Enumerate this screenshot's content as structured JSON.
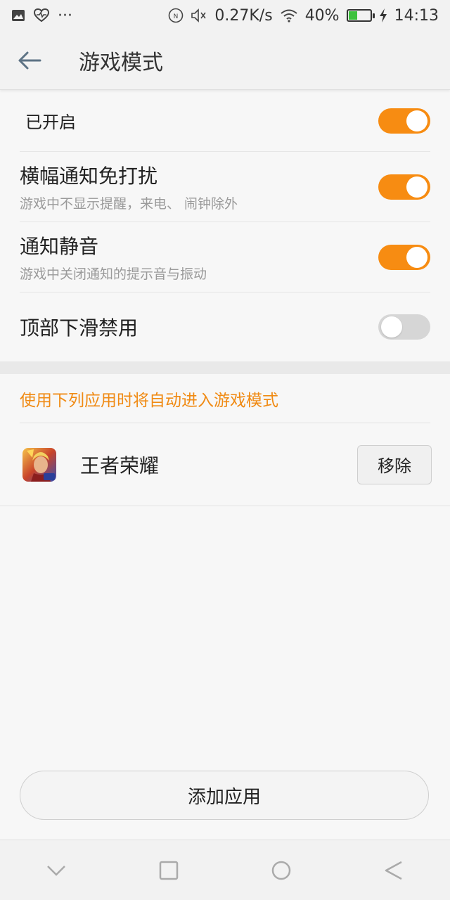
{
  "status_bar": {
    "left_icons": [
      "image-icon",
      "heart-pulse-icon",
      "more-icon"
    ],
    "more_glyph": "···",
    "net_speed": "0.27K/s",
    "battery_percent_text": "40%",
    "battery_level": 0.4,
    "time": "14:13"
  },
  "header": {
    "title": "游戏模式"
  },
  "settings": [
    {
      "title": "已开启",
      "subtitle": "",
      "on": true
    },
    {
      "title": "横幅通知免打扰",
      "subtitle": "游戏中不显示提醒，来电、 闹钟除外",
      "on": true
    },
    {
      "title": "通知静音",
      "subtitle": "游戏中关闭通知的提示音与振动",
      "on": true
    },
    {
      "title": "顶部下滑禁用",
      "subtitle": "",
      "on": false
    }
  ],
  "section_header": "使用下列应用时将自动进入游戏模式",
  "apps": [
    {
      "name": "王者荣耀",
      "remove_label": "移除"
    }
  ],
  "add_app_label": "添加应用",
  "colors": {
    "accent": "#f78c12",
    "section_text": "#f08a13",
    "toggle_off": "#d6d6d6"
  },
  "nav_icons": [
    "back-chevron-icon",
    "square-recent-icon",
    "circle-home-icon",
    "back-triangle-icon"
  ]
}
